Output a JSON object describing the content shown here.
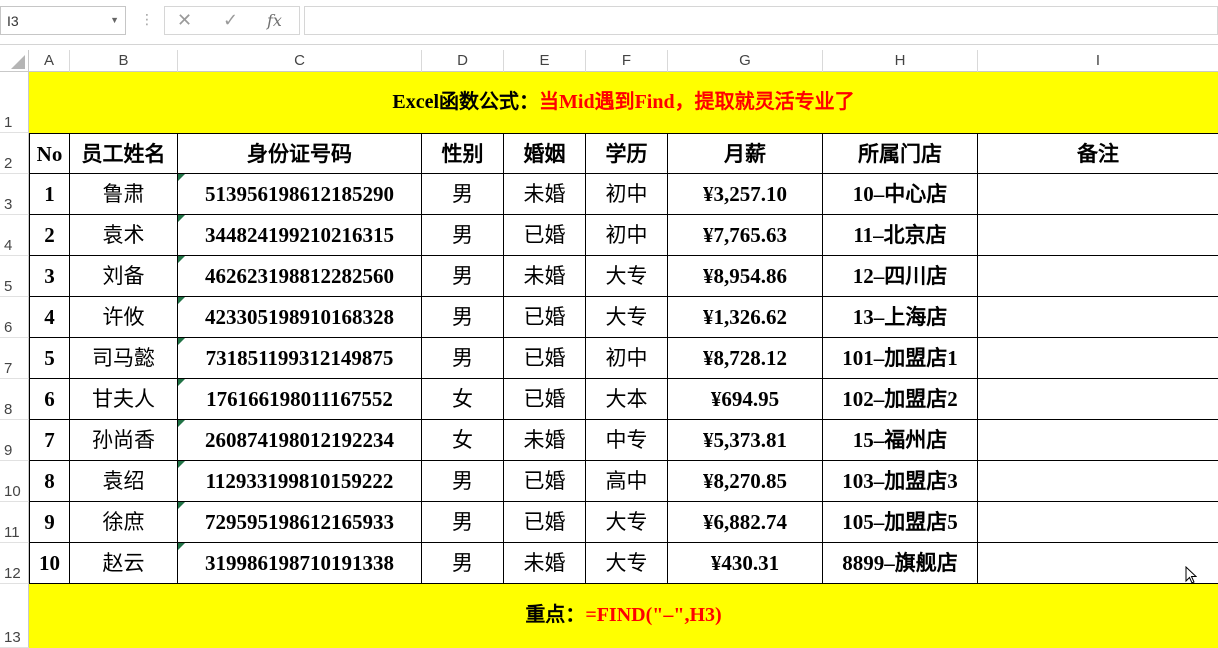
{
  "formula_bar": {
    "name_box": "I3",
    "cancel_icon": "✕",
    "enter_icon": "✓",
    "fx_label": "fx",
    "formula": ""
  },
  "columns": [
    "A",
    "B",
    "C",
    "D",
    "E",
    "F",
    "G",
    "H",
    "I"
  ],
  "rows": [
    "1",
    "2",
    "3",
    "4",
    "5",
    "6",
    "7",
    "8",
    "9",
    "10",
    "11",
    "12",
    "13"
  ],
  "title": {
    "black": "Excel函数公式：",
    "red": "当Mid遇到Find，提取就灵活专业了"
  },
  "headers": [
    "No",
    "员工姓名",
    "身份证号码",
    "性别",
    "婚姻",
    "学历",
    "月薪",
    "所属门店",
    "备注"
  ],
  "data": [
    [
      "1",
      "鲁肃",
      "513956198612185290",
      "男",
      "未婚",
      "初中",
      "¥3,257.10",
      "10–中心店",
      ""
    ],
    [
      "2",
      "袁术",
      "344824199210216315",
      "男",
      "已婚",
      "初中",
      "¥7,765.63",
      "11–北京店",
      ""
    ],
    [
      "3",
      "刘备",
      "462623198812282560",
      "男",
      "未婚",
      "大专",
      "¥8,954.86",
      "12–四川店",
      ""
    ],
    [
      "4",
      "许攸",
      "423305198910168328",
      "男",
      "已婚",
      "大专",
      "¥1,326.62",
      "13–上海店",
      ""
    ],
    [
      "5",
      "司马懿",
      "731851199312149875",
      "男",
      "已婚",
      "初中",
      "¥8,728.12",
      "101–加盟店1",
      ""
    ],
    [
      "6",
      "甘夫人",
      "176166198011167552",
      "女",
      "已婚",
      "大本",
      "¥694.95",
      "102–加盟店2",
      ""
    ],
    [
      "7",
      "孙尚香",
      "260874198012192234",
      "女",
      "未婚",
      "中专",
      "¥5,373.81",
      "15–福州店",
      ""
    ],
    [
      "8",
      "袁绍",
      "112933199810159222",
      "男",
      "已婚",
      "高中",
      "¥8,270.85",
      "103–加盟店3",
      ""
    ],
    [
      "9",
      "徐庶",
      "729595198612165933",
      "男",
      "已婚",
      "大专",
      "¥6,882.74",
      "105–加盟店5",
      ""
    ],
    [
      "10",
      "赵云",
      "319986198710191338",
      "男",
      "未婚",
      "大专",
      "¥430.31",
      "8899–旗舰店",
      ""
    ]
  ],
  "footer": {
    "black": "重点：",
    "red": "=FIND(\"–\",H3)"
  },
  "colors": {
    "banner_bg": "#ffff00",
    "accent_red": "#ff0000",
    "excel_green": "#217346"
  }
}
